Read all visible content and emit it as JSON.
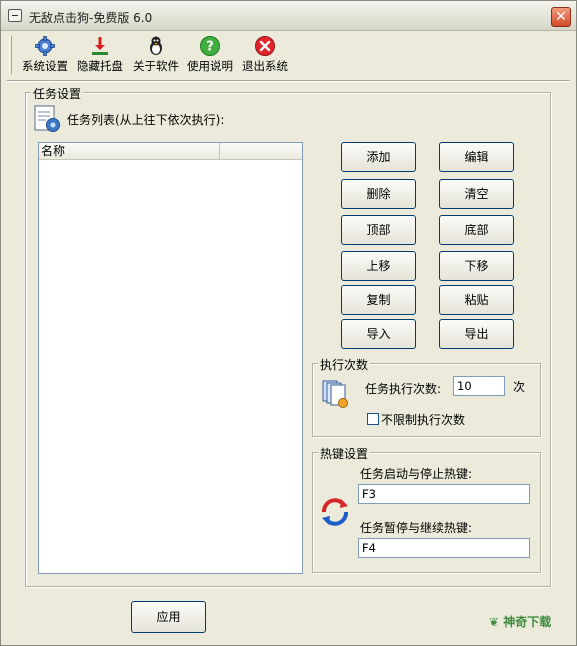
{
  "window": {
    "title": "无敌点击狗-免费版 6.0"
  },
  "toolbar": {
    "items": [
      {
        "label": "系统设置",
        "icon": "gear-icon"
      },
      {
        "label": "隐藏托盘",
        "icon": "tray-down-icon"
      },
      {
        "label": "关于软件",
        "icon": "penguin-icon"
      },
      {
        "label": "使用说明",
        "icon": "help-icon"
      },
      {
        "label": "退出系统",
        "icon": "exit-icon"
      }
    ]
  },
  "task": {
    "group_title": "任务设置",
    "list_caption": "任务列表(从上往下依次执行):",
    "column_name": "名称",
    "buttons": {
      "add": "添加",
      "edit": "编辑",
      "delete": "删除",
      "clear": "清空",
      "top": "顶部",
      "bottom": "底部",
      "up": "上移",
      "down": "下移",
      "copy": "复制",
      "paste": "粘贴",
      "import": "导入",
      "export": "导出"
    }
  },
  "exec": {
    "group_title": "执行次数",
    "count_label": "任务执行次数:",
    "count_value": "10",
    "unit": "次",
    "unlimited_label": "不限制执行次数",
    "unlimited_checked": false
  },
  "hotkey": {
    "group_title": "热键设置",
    "start_stop_label": "任务启动与停止热键:",
    "start_stop_value": "F3",
    "pause_resume_label": "任务暂停与继续热键:",
    "pause_resume_value": "F4"
  },
  "footer": {
    "apply_label": "应用"
  },
  "watermark": {
    "text": "神奇下载"
  },
  "colors": {
    "accent_border": "#003c74",
    "close_red": "#d0492a"
  }
}
